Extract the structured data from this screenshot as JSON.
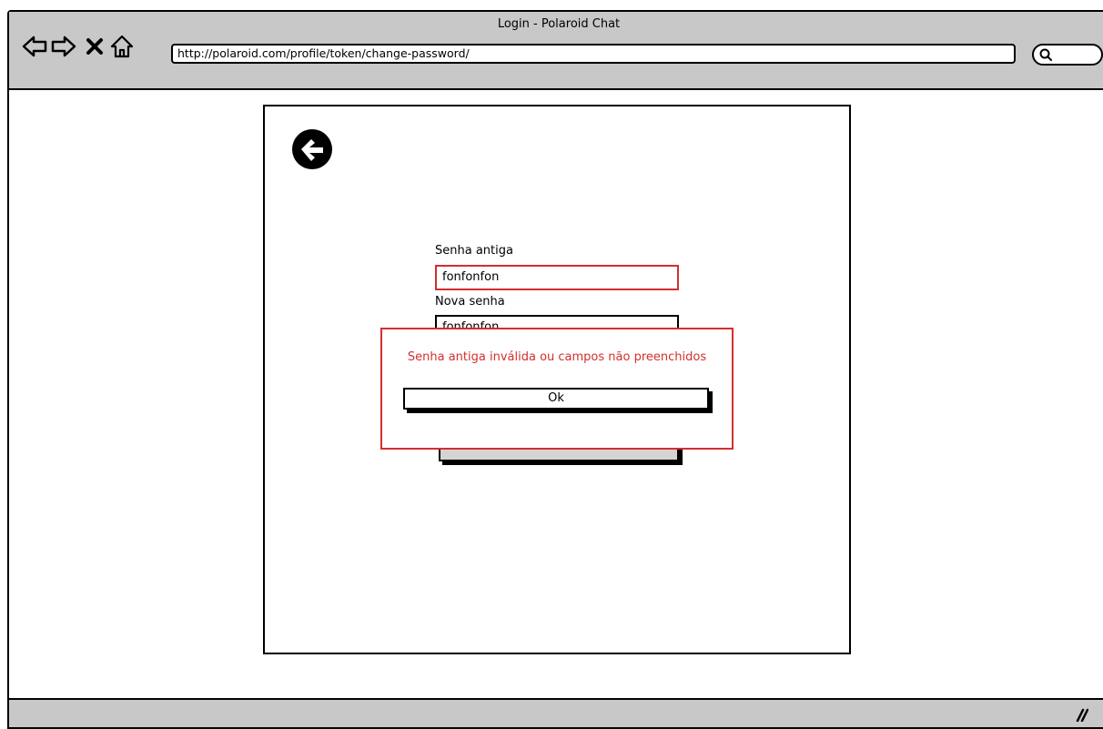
{
  "window": {
    "title": "Login - Polaroid Chat",
    "url": "http://polaroid.com/profile/token/change-password/"
  },
  "form": {
    "old_password_label": "Senha antiga",
    "old_password_value": "fonfonfon",
    "new_password_label": "Nova senha",
    "new_password_value": "fonfonfon"
  },
  "dialog": {
    "message": "Senha antiga inválida ou campos não preenchidos",
    "ok_label": "Ok"
  },
  "colors": {
    "error": "#d32f2f",
    "chrome": "#c8c8c8"
  },
  "icons": [
    "back-nav-icon",
    "forward-nav-icon",
    "close-icon",
    "home-icon",
    "search-icon",
    "resize-icon",
    "back-arrow-icon"
  ]
}
